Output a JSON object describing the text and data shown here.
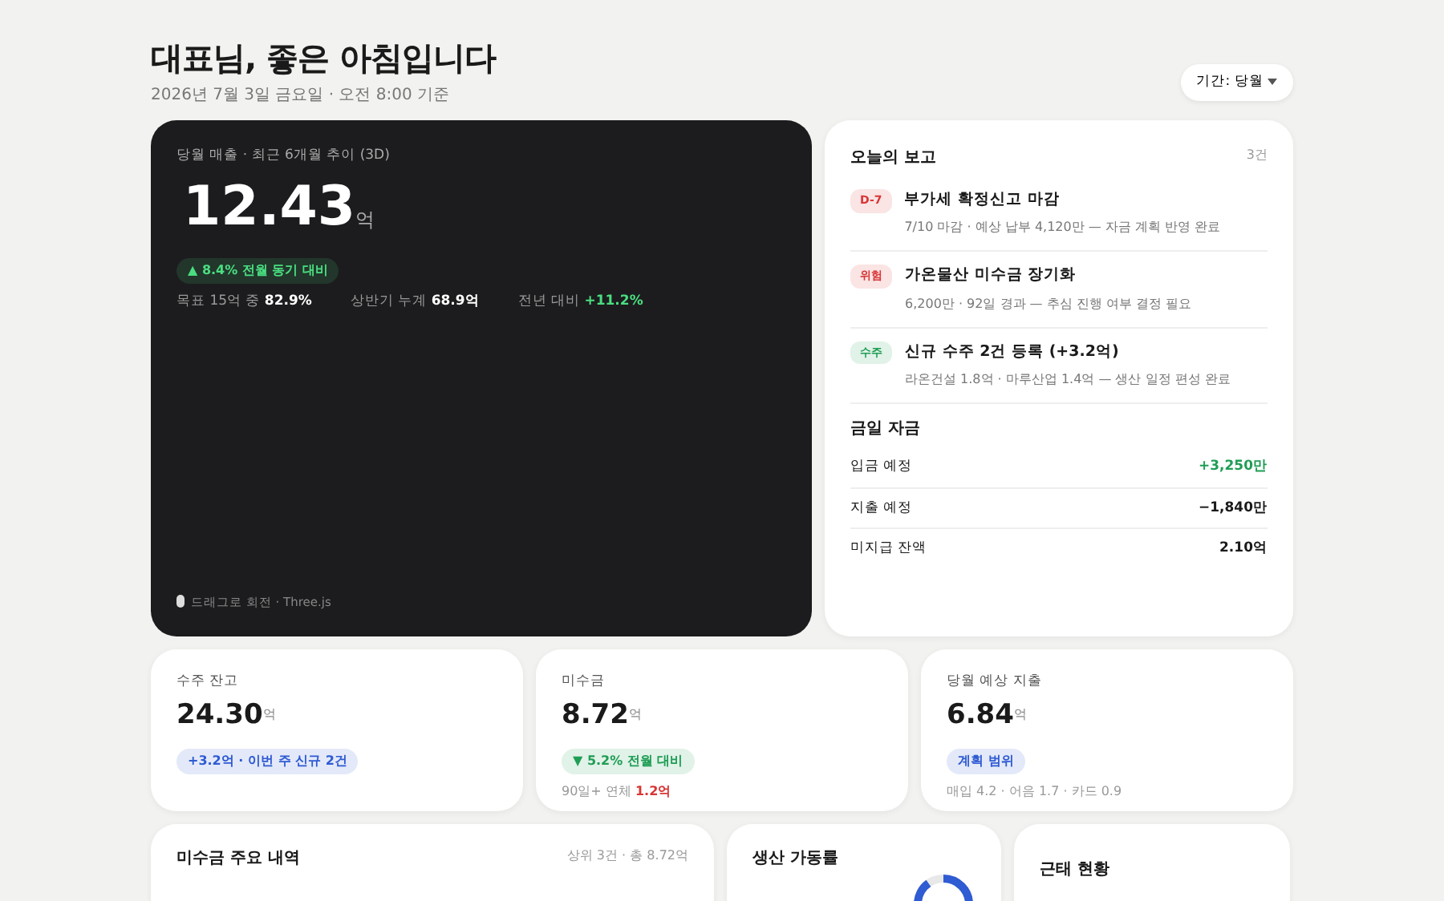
{
  "header": {
    "title": "대표님, 좋은 아침입니다",
    "subtitle": "2026년 7월 3일 금요일 · 오전 8:00 기준",
    "period_button": "기간: 당월"
  },
  "hero": {
    "caption": "당월 매출 · 최근 6개월 추이 (3D)",
    "value": "12.43",
    "unit": "억",
    "badge": {
      "text": "▲ 8.4% 전월 동기 대비",
      "color": "#4ade80"
    },
    "stats": [
      {
        "label": "목표 15억 중",
        "value": "82.9%",
        "color": "#ffffff"
      },
      {
        "label": "상반기 누계",
        "value": "68.9억",
        "color": "#ffffff"
      },
      {
        "label": "전년 대비",
        "value": "+11.2%",
        "color": "#4ade80"
      }
    ],
    "hint": "드래그로 회전 · Three.js"
  },
  "report": {
    "title": "오늘의 보고",
    "count": "3건",
    "items": [
      {
        "tag": "D-7",
        "color": "#d93636",
        "title": "부가세 확정신고 마감",
        "detail": "7/10 마감 · 예상 납부 4,120만 — 자금 계획 반영 완료"
      },
      {
        "tag": "위험",
        "color": "#d93636",
        "title": "가온물산 미수금 장기화",
        "detail": "6,200만 · 92일 경과 — 추심 진행 여부 결정 필요"
      },
      {
        "tag": "수주",
        "color": "#1f9d55",
        "title": "신규 수주 2건 등록 (+3.2억)",
        "detail": "라온건설 1.8억 · 마루산업 1.4억 — 생산 일정 편성 완료"
      }
    ],
    "cash": {
      "title": "금일 자금",
      "rows": [
        {
          "label": "입금 예정",
          "value": "+3,250만",
          "color": "#1f9d55"
        },
        {
          "label": "지출 예정",
          "value": "−1,840만",
          "color": "#1a1a1a"
        },
        {
          "label": "미지급 잔액",
          "value": "2.10억",
          "color": "#1a1a1a"
        }
      ]
    }
  },
  "kpis": [
    {
      "label": "수주 잔고",
      "value": "24.30",
      "unit": "억",
      "badge": {
        "text": "+3.2억 · 이번 주 신규 2건",
        "color": "#2f5bd3"
      }
    },
    {
      "label": "미수금",
      "value": "8.72",
      "unit": "억",
      "badge": {
        "text": "▼ 5.2% 전월 대비",
        "color": "#1f9d55"
      },
      "note": {
        "text": "90일+ 연체",
        "value": "1.2억",
        "color": "#d93636"
      }
    },
    {
      "label": "당월 예상 지출",
      "value": "6.84",
      "unit": "억",
      "badge": {
        "text": "계획 범위",
        "color": "#2f5bd3"
      },
      "note": {
        "text": "매입 4.2 · 어음 1.7 · 카드 0.9"
      }
    }
  ],
  "receivables": {
    "title": "미수금 주요 내역",
    "meta": "상위 3건 · 총 8.72억"
  },
  "utilization": {
    "title": "생산 가동률",
    "level": 0.9
  },
  "attendance": {
    "title": "근태 현황"
  }
}
